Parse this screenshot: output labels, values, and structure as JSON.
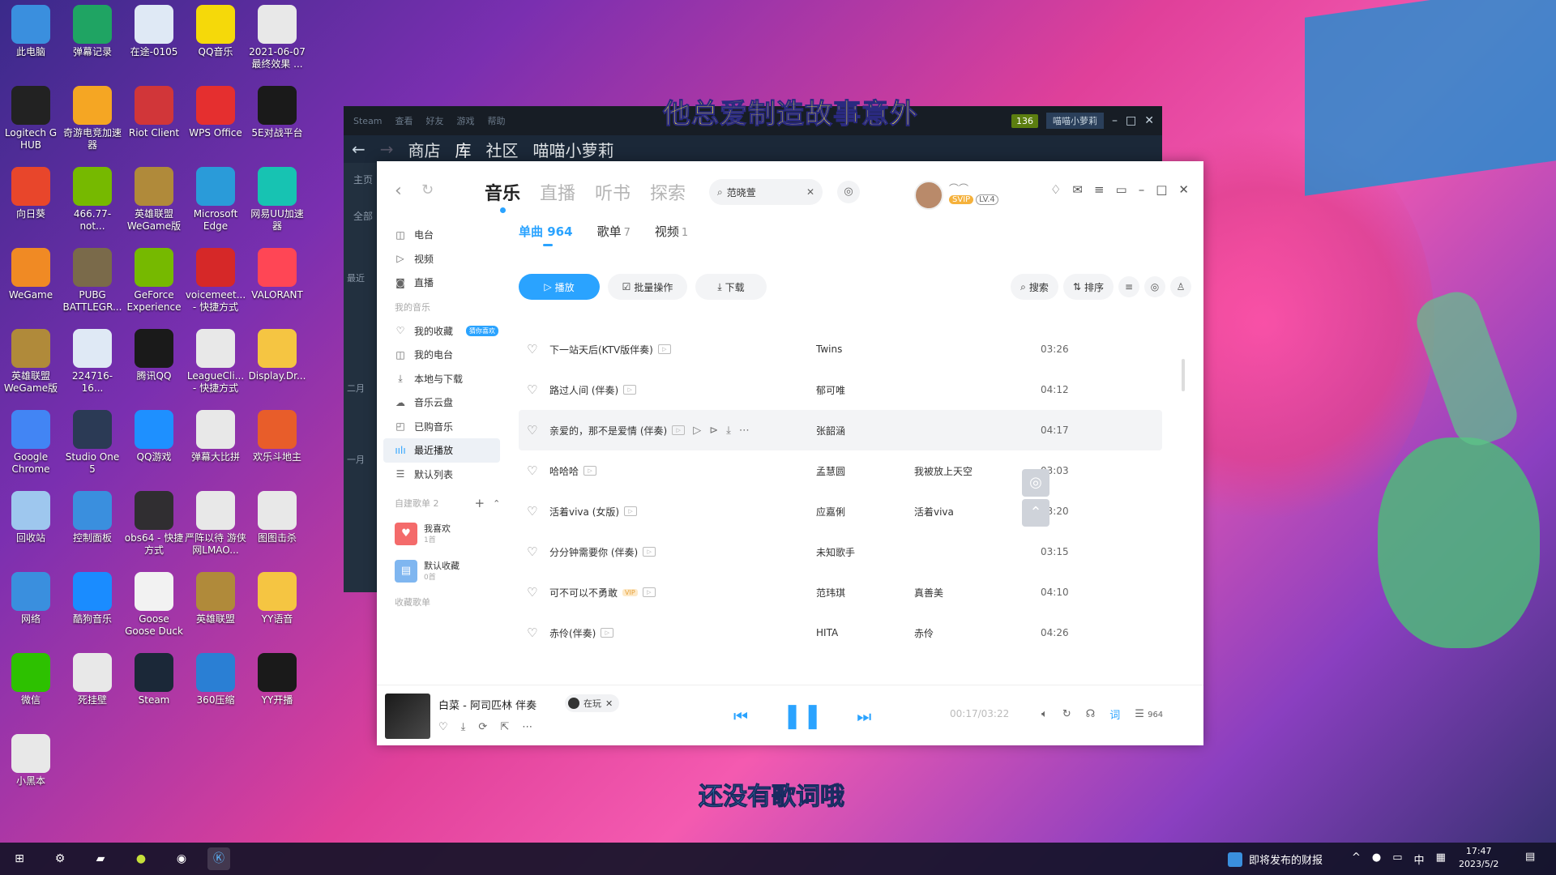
{
  "desktop": {
    "icons": [
      {
        "label": "此电脑",
        "icon": "computer-icon",
        "color": "#3a8fde"
      },
      {
        "label": "弹幕记录",
        "icon": "spreadsheet-icon",
        "color": "#1fa463"
      },
      {
        "label": "在途-0105",
        "icon": "image-file-icon",
        "color": "#dfe9f5"
      },
      {
        "label": "QQ音乐",
        "icon": "qq-music-icon",
        "color": "#f5d90a"
      },
      {
        "label": "2021-06-07 最终效果 ...",
        "icon": "file-icon",
        "color": "#e8e8e8"
      },
      {
        "label": "Logitech G HUB",
        "icon": "logitech-icon",
        "color": "#222222"
      },
      {
        "label": "奇游电竞加速器",
        "icon": "accelerator-icon",
        "color": "#f5a623"
      },
      {
        "label": "Riot Client",
        "icon": "riot-icon",
        "color": "#d13639"
      },
      {
        "label": "WPS Office",
        "icon": "wps-icon",
        "color": "#e52f2f"
      },
      {
        "label": "5E对战平台",
        "icon": "5e-icon",
        "color": "#1a1a1a"
      },
      {
        "label": "向日葵",
        "icon": "sunflower-icon",
        "color": "#e8462b"
      },
      {
        "label": "466.77-not...",
        "icon": "nvidia-icon",
        "color": "#76b900"
      },
      {
        "label": "英雄联盟 WeGame版",
        "icon": "lol-icon",
        "color": "#b08a3a"
      },
      {
        "label": "Microsoft Edge",
        "icon": "edge-icon",
        "color": "#2a9bd9"
      },
      {
        "label": "网易UU加速器",
        "icon": "uu-icon",
        "color": "#17c3b2"
      },
      {
        "label": "WeGame",
        "icon": "wegame-icon",
        "color": "#f08a24"
      },
      {
        "label": "PUBG BATTLEGR...",
        "icon": "pubg-icon",
        "color": "#7a6a4a"
      },
      {
        "label": "GeForce Experience",
        "icon": "geforce-icon",
        "color": "#76b900"
      },
      {
        "label": "voicemeet... - 快捷方式",
        "icon": "voicemeeter-icon",
        "color": "#d62828"
      },
      {
        "label": "VALORANT",
        "icon": "valorant-icon",
        "color": "#ff4655"
      },
      {
        "label": "英雄联盟 WeGame版",
        "icon": "lol-icon",
        "color": "#b08a3a"
      },
      {
        "label": "224716-16...",
        "icon": "image-file-icon",
        "color": "#dfe9f5"
      },
      {
        "label": "腾讯QQ",
        "icon": "qq-icon",
        "color": "#1a1a1a"
      },
      {
        "label": "LeagueCli... - 快捷方式",
        "icon": "file-icon",
        "color": "#e8e8e8"
      },
      {
        "label": "Display.Dr...",
        "icon": "folder-icon",
        "color": "#f5c542"
      },
      {
        "label": "Google Chrome",
        "icon": "chrome-icon",
        "color": "#4285f4"
      },
      {
        "label": "Studio One 5",
        "icon": "studio-one-icon",
        "color": "#2b3a55"
      },
      {
        "label": "QQ游戏",
        "icon": "qq-game-icon",
        "color": "#1e90ff"
      },
      {
        "label": "弹幕大比拼",
        "icon": "file-icon",
        "color": "#e8e8e8"
      },
      {
        "label": "欢乐斗地主",
        "icon": "landlord-icon",
        "color": "#e85d2a"
      },
      {
        "label": "回收站",
        "icon": "recycle-bin-icon",
        "color": "#9ec7ee"
      },
      {
        "label": "控制面板",
        "icon": "control-panel-icon",
        "color": "#3a8fde"
      },
      {
        "label": "obs64 - 快捷方式",
        "icon": "obs-icon",
        "color": "#302e31"
      },
      {
        "label": "严阵以待 游侠网LMAO...",
        "icon": "file-icon",
        "color": "#e8e8e8"
      },
      {
        "label": "图图击杀",
        "icon": "file-icon",
        "color": "#e8e8e8"
      },
      {
        "label": "网络",
        "icon": "network-icon",
        "color": "#3a8fde"
      },
      {
        "label": "酷狗音乐",
        "icon": "kugou-icon",
        "color": "#1a8cff"
      },
      {
        "label": "Goose Goose Duck",
        "icon": "goose-icon",
        "color": "#f2f2f2"
      },
      {
        "label": "英雄联盟",
        "icon": "lol-icon",
        "color": "#b08a3a"
      },
      {
        "label": "YY语音",
        "icon": "yy-icon",
        "color": "#f5c542"
      },
      {
        "label": "微信",
        "icon": "wechat-icon",
        "color": "#2dc100"
      },
      {
        "label": "死挂壁",
        "icon": "file-icon",
        "color": "#e8e8e8"
      },
      {
        "label": "Steam",
        "icon": "steam-icon",
        "color": "#1b2838"
      },
      {
        "label": "360压缩",
        "icon": "zip-icon",
        "color": "#2a7fd4"
      },
      {
        "label": "YY开播",
        "icon": "yy-live-icon",
        "color": "#1a1a1a"
      },
      {
        "label": "小黑本",
        "icon": "file-icon",
        "color": "#e8e8e8"
      }
    ]
  },
  "overlay": {
    "lyric_top": "他总爱制造故事意外",
    "lyric_bottom": "还没有歌词哦"
  },
  "steam": {
    "menu": [
      "Steam",
      "查看",
      "好友",
      "游戏",
      "帮助"
    ],
    "nav": [
      "商店",
      "库",
      "社区",
      "喵喵小萝莉"
    ],
    "badge": "136",
    "user": "喵喵小萝莉",
    "side": [
      "主页",
      "全部",
      "最近",
      "二月",
      "一月"
    ]
  },
  "kugou": {
    "tabs": [
      "音乐",
      "直播",
      "听书",
      "探索"
    ],
    "search_value": "范晓萱",
    "vip": "SVIP",
    "level": "LV.4",
    "sidebar": {
      "top": [
        "电台",
        "视频",
        "直播"
      ],
      "my_music_label": "我的音乐",
      "my_music": [
        "我的收藏",
        "我的电台",
        "本地与下载",
        "音乐云盘",
        "已购音乐",
        "最近播放",
        "默认列表"
      ],
      "fav_tag": "猜你喜欢",
      "created_label": "自建歌单 2",
      "playlists": [
        {
          "name": "我喜欢",
          "count": "1首"
        },
        {
          "name": "默认收藏",
          "count": "0首"
        }
      ],
      "collected_label": "收藏歌单"
    },
    "subtabs": [
      {
        "label": "单曲",
        "count": "964"
      },
      {
        "label": "歌单",
        "count": "7"
      },
      {
        "label": "视频",
        "count": "1"
      }
    ],
    "actions": {
      "play": "播放",
      "batch": "批量操作",
      "download": "下载",
      "search": "搜索",
      "sort": "排序"
    },
    "songs": [
      {
        "title": "下一站天后(KTV版伴奏)",
        "artist": "Twins",
        "album": "",
        "duration": "03:26",
        "vip": false
      },
      {
        "title": "路过人间 (伴奏)",
        "artist": "郁可唯",
        "album": "",
        "duration": "04:12",
        "vip": false
      },
      {
        "title": "亲爱的，那不是爱情 (伴奏)",
        "artist": "张韶涵",
        "album": "",
        "duration": "04:17",
        "vip": false
      },
      {
        "title": "哈哈哈",
        "artist": "孟慧圆",
        "album": "我被放上天空",
        "duration": "03:03",
        "vip": false
      },
      {
        "title": "活着viva (女版)",
        "artist": "应嘉俐",
        "album": "活着viva",
        "duration": "03:20",
        "vip": false
      },
      {
        "title": "分分钟需要你 (伴奏)",
        "artist": "未知歌手",
        "album": "",
        "duration": "03:15",
        "vip": false
      },
      {
        "title": "可不可以不勇敢",
        "artist": "范玮琪",
        "album": "真善美",
        "duration": "04:10",
        "vip": true
      },
      {
        "title": "赤伶(伴奏)",
        "artist": "HITA",
        "album": "赤伶",
        "duration": "04:26",
        "vip": false
      }
    ],
    "vip_badge": "VIP",
    "player": {
      "title": "白菜 - 阿司匹林 伴奏",
      "playing_label": "在玩",
      "time": "00:17/03:22",
      "lyric_button": "词",
      "queue_count": "964"
    }
  },
  "taskbar": {
    "news": "即将发布的财报",
    "ime": "中",
    "time": "17:47",
    "date": "2023/5/2"
  }
}
